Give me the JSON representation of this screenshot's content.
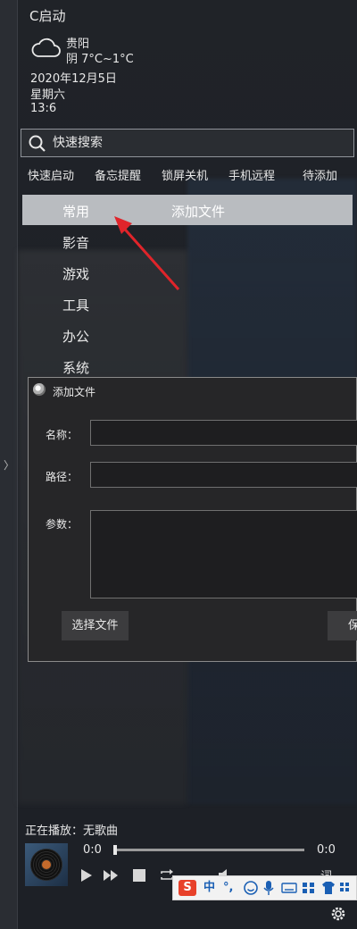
{
  "app": {
    "title": "C启动"
  },
  "weather": {
    "icon": "cloud-icon",
    "city": "贵阳",
    "desc": "阴 7°C~1°C",
    "date": "2020年12月5日",
    "weekday": "星期六",
    "time": "13:6"
  },
  "search": {
    "placeholder": "快速搜索"
  },
  "quick_tabs": [
    "快速启动",
    "备忘提醒",
    "锁屏关机",
    "手机远程",
    "待添加"
  ],
  "categories": [
    "常用",
    "影音",
    "游戏",
    "工具",
    "办公",
    "系统"
  ],
  "selected_category": "常用",
  "add_file_link": "添加文件",
  "dialog": {
    "title": "添加文件",
    "name_label": "名称：",
    "path_label": "路径：",
    "params_label": "参数：",
    "choose_button": "选择文件",
    "save_button_partial": "保"
  },
  "player": {
    "now_playing": "正在播放：无歌曲",
    "current_time": "0:0",
    "total_time": "0:0",
    "progress": 0,
    "lyrics_partial": "词"
  },
  "ime": {
    "zh_label": "中",
    "punct_label": "°,"
  },
  "colors": {
    "panel_bg": "#1e2127",
    "highlight": "#b9bcc0",
    "arrow": "#e0242a",
    "ime_logo": "#e8412a"
  }
}
